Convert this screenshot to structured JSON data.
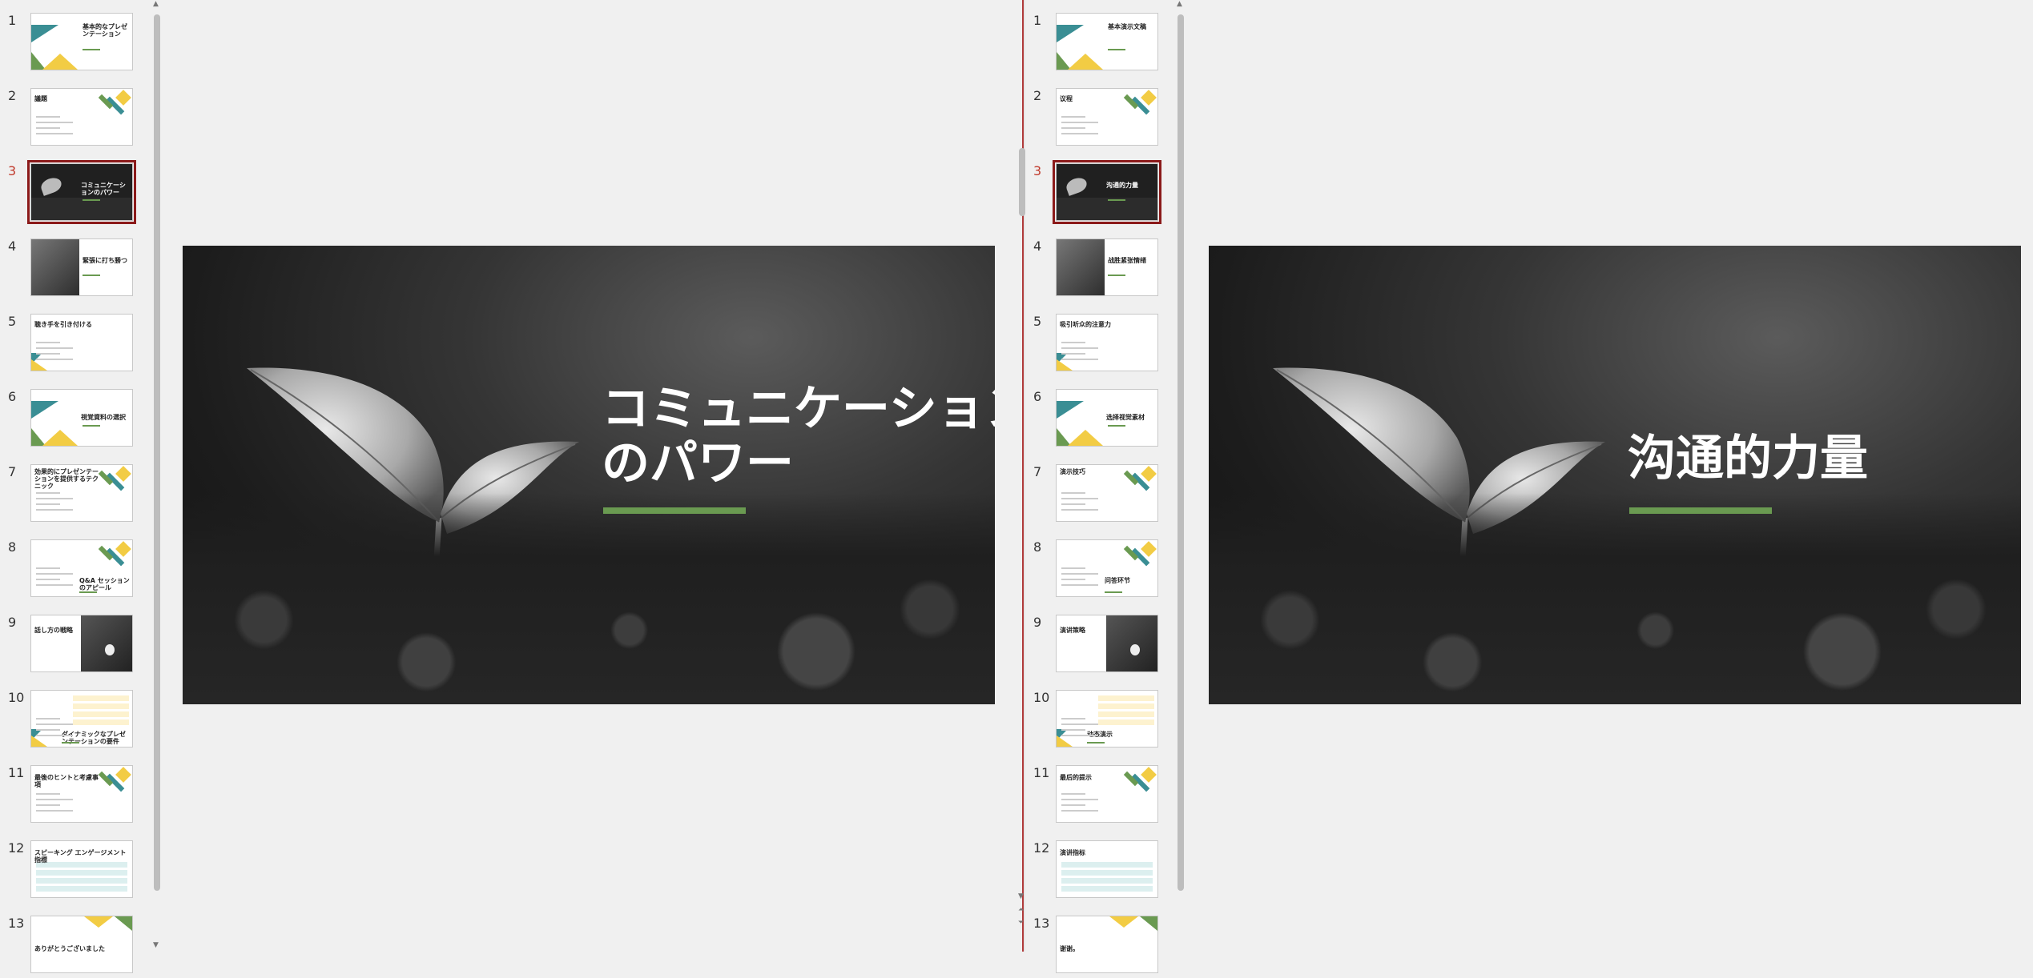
{
  "colors": {
    "accent_green": "#6a9a51",
    "teal": "#3a8e94",
    "yellow": "#f2cc44",
    "active_border": "#8b1a1a",
    "active_number": "#c0392b"
  },
  "left_panel": {
    "active_slide": 3,
    "thumbnails": [
      {
        "num": "1",
        "title": "基本的なプレゼンテーション"
      },
      {
        "num": "2",
        "title": "議題"
      },
      {
        "num": "3",
        "title": "コミュニケーションのパワー"
      },
      {
        "num": "4",
        "title": "緊張に打ち勝つ"
      },
      {
        "num": "5",
        "title": "聴き手を引き付ける"
      },
      {
        "num": "6",
        "title": "視覚資料の選択"
      },
      {
        "num": "7",
        "title": "効果的にプレゼンテーションを提供するテクニック"
      },
      {
        "num": "8",
        "title": "Q&A セッションのアピール"
      },
      {
        "num": "9",
        "title": "話し方の戦略"
      },
      {
        "num": "10",
        "title": "ダイナミックなプレゼンテーションの要件"
      },
      {
        "num": "11",
        "title": "最後のヒントと考慮事項"
      },
      {
        "num": "12",
        "title": "スピーキング エンゲージメント指標"
      },
      {
        "num": "13",
        "title": "ありがとうございました"
      }
    ],
    "slide": {
      "title": "コミュニケーション\nのパワー"
    }
  },
  "right_panel": {
    "active_slide": 3,
    "thumbnails": [
      {
        "num": "1",
        "title": "基本演示文稿"
      },
      {
        "num": "2",
        "title": "议程"
      },
      {
        "num": "3",
        "title": "沟通的力量"
      },
      {
        "num": "4",
        "title": "战胜紧张情绪"
      },
      {
        "num": "5",
        "title": "吸引听众的注意力"
      },
      {
        "num": "6",
        "title": "选择视觉素材"
      },
      {
        "num": "7",
        "title": "演示技巧"
      },
      {
        "num": "8",
        "title": "问答环节"
      },
      {
        "num": "9",
        "title": "演讲策略"
      },
      {
        "num": "10",
        "title": "动态演示"
      },
      {
        "num": "11",
        "title": "最后的提示"
      },
      {
        "num": "12",
        "title": "演讲指标"
      },
      {
        "num": "13",
        "title": "谢谢。"
      }
    ],
    "slide": {
      "title": "沟通的力量"
    }
  }
}
